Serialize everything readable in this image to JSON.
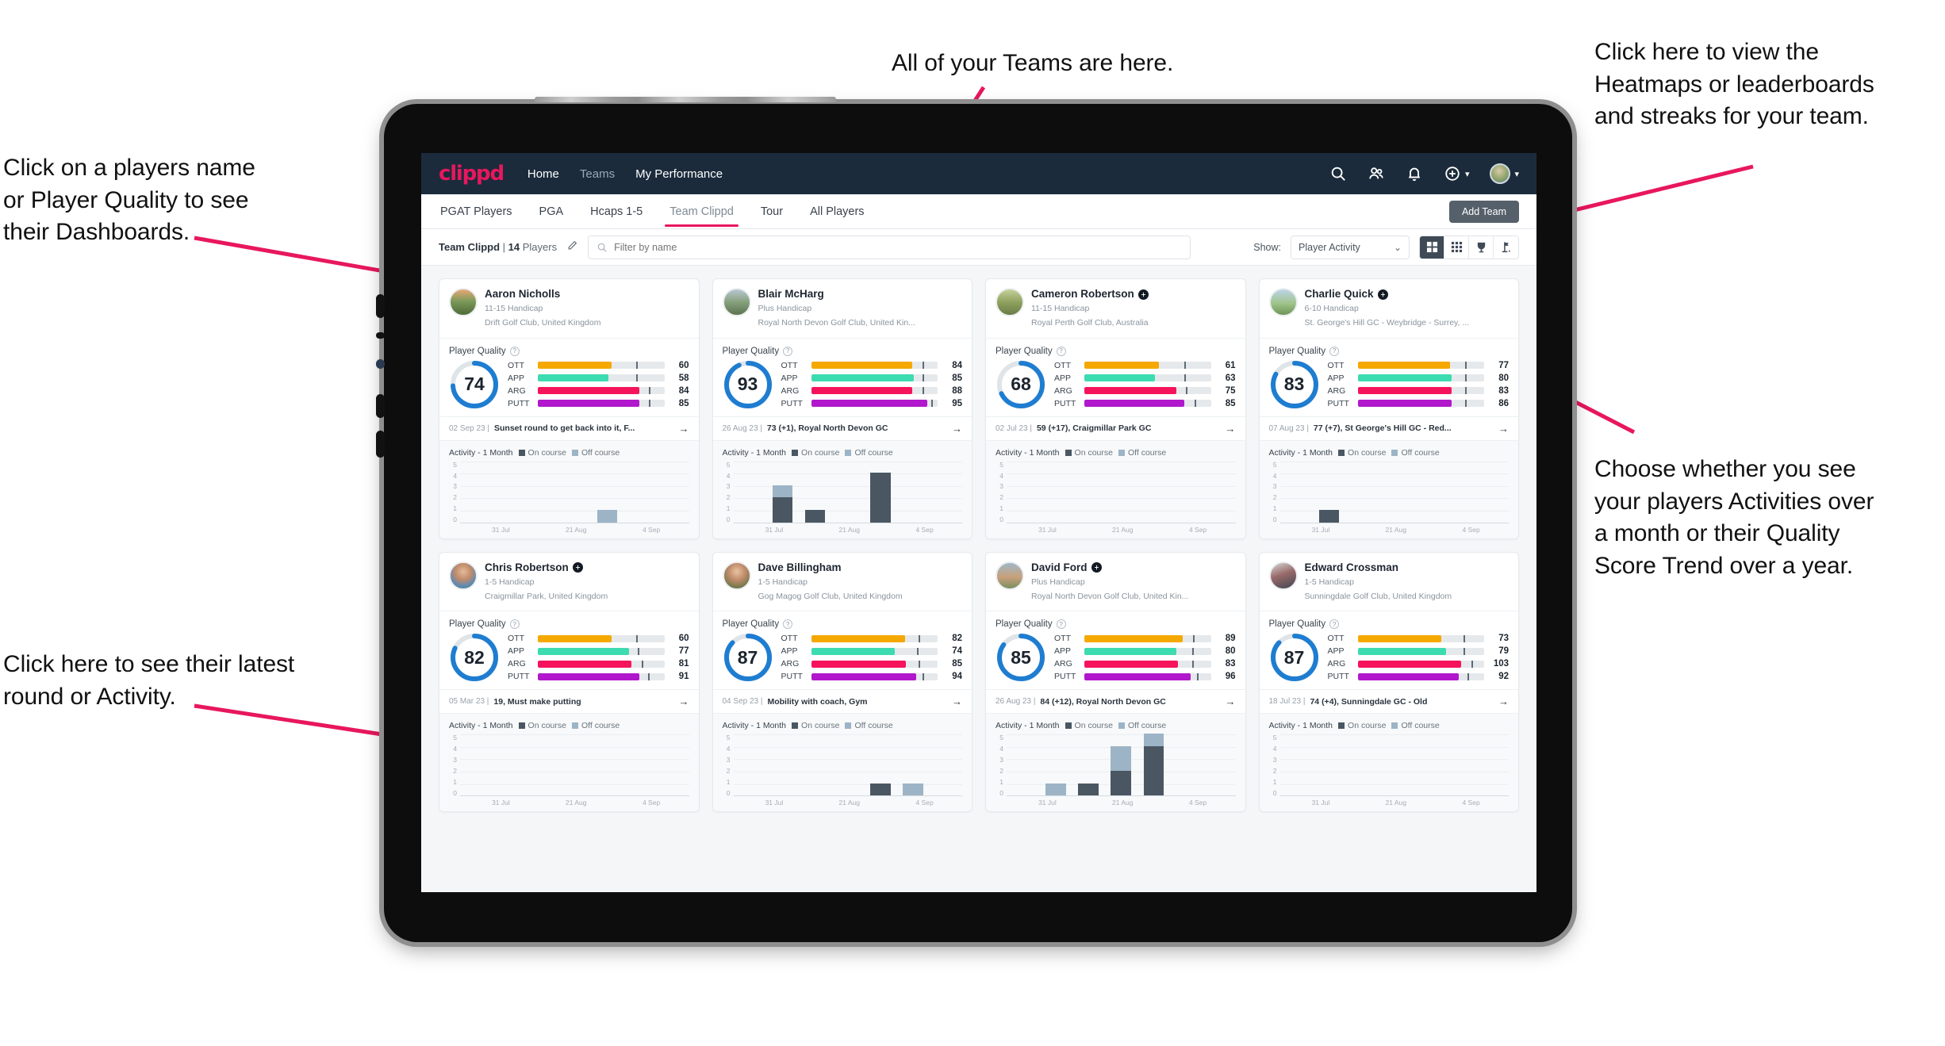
{
  "annotations": {
    "teams": "All of your Teams are here.",
    "right_top": "Click here to view the\nHeatmaps or leaderboards\nand streaks for your team.",
    "left_top": "Click on a players name\nor Player Quality to see\ntheir Dashboards.",
    "right_bottom": "Choose whether you see\nyour players Activities over\na month or their Quality\nScore Trend over a year.",
    "left_bottom": "Click here to see their latest\nround or Activity."
  },
  "colors": {
    "brand": "#e8175d",
    "nav_bg": "#1b2b3c",
    "ott": "#f5a800",
    "app": "#3ddbb0",
    "arg": "#f5145c",
    "putt": "#b117cc",
    "ring": "#1e7dd1",
    "on_course": "#4a5763",
    "off_course": "#9db4c6"
  },
  "topnav": {
    "brand": "clippd",
    "links": [
      {
        "label": "Home",
        "dim": false
      },
      {
        "label": "Teams",
        "dim": true
      },
      {
        "label": "My Performance",
        "dim": false
      }
    ],
    "icons": [
      "search-icon",
      "people-icon",
      "bell-icon",
      "plus-circle-icon",
      "avatar"
    ]
  },
  "tabs": {
    "items": [
      {
        "label": "PGAT Players",
        "active": false
      },
      {
        "label": "PGA",
        "active": false
      },
      {
        "label": "Hcaps 1-5",
        "active": false
      },
      {
        "label": "Team Clippd",
        "active": true
      },
      {
        "label": "Tour",
        "active": false
      },
      {
        "label": "All Players",
        "active": false
      }
    ],
    "add_team_label": "Add Team"
  },
  "filterbar": {
    "team_name": "Team Clippd",
    "separator": " | ",
    "player_count": "14",
    "players_word": " Players",
    "edit_icon": "pencil-icon",
    "search_placeholder": "Filter by name",
    "search_value": "",
    "show_label": "Show:",
    "show_value": "Player Activity",
    "show_options": [
      "Player Activity",
      "Quality Score Trend"
    ],
    "view_toggles": [
      {
        "name": "grid-large-view",
        "selected": true
      },
      {
        "name": "grid-small-view",
        "selected": false
      },
      {
        "name": "trophy-leaderboard-view",
        "selected": false
      },
      {
        "name": "heatmap-flag-view",
        "selected": false
      }
    ]
  },
  "card_labels": {
    "player_quality": "Player Quality",
    "activity": "Activity - 1 Month",
    "on_course": "On course",
    "off_course": "Off course",
    "metrics": [
      "OTT",
      "APP",
      "ARG",
      "PUTT"
    ],
    "y_ticks": [
      "5",
      "4",
      "3",
      "2",
      "1",
      "0"
    ],
    "x_ticks": [
      "31 Jul",
      "21 Aug",
      "4 Sep"
    ]
  },
  "players": [
    {
      "name": "Aaron Nicholls",
      "verified": false,
      "handicap": "11-15 Handicap",
      "club": "Drift Golf Club, United Kingdom",
      "quality": 74,
      "metrics": [
        {
          "label": "OTT",
          "value": 60,
          "fill": 58,
          "tick": 78
        },
        {
          "label": "APP",
          "value": 58,
          "fill": 56,
          "tick": 78
        },
        {
          "label": "ARG",
          "value": 84,
          "fill": 80,
          "tick": 88
        },
        {
          "label": "PUTT",
          "value": 85,
          "fill": 80,
          "tick": 88
        }
      ],
      "round_date": "02 Sep 23",
      "round_text": "Sunset round to get back into it, F...",
      "chart_data": {
        "type": "bar",
        "categories": [
          "31 Jul",
          "21 Aug",
          "4 Sep"
        ],
        "ylim": [
          0,
          5
        ],
        "series": [
          {
            "name": "On course",
            "values": [
              0,
              0,
              0,
              0,
              0,
              0,
              0
            ]
          },
          {
            "name": "Off course",
            "values": [
              0,
              0,
              0,
              0,
              1,
              0,
              0
            ]
          }
        ]
      }
    },
    {
      "name": "Blair McHarg",
      "verified": false,
      "handicap": "Plus Handicap",
      "club": "Royal North Devon Golf Club, United Kin...",
      "quality": 93,
      "metrics": [
        {
          "label": "OTT",
          "value": 84,
          "fill": 80,
          "tick": 88
        },
        {
          "label": "APP",
          "value": 85,
          "fill": 81,
          "tick": 88
        },
        {
          "label": "ARG",
          "value": 88,
          "fill": 80,
          "tick": 88
        },
        {
          "label": "PUTT",
          "value": 95,
          "fill": 92,
          "tick": 95
        }
      ],
      "round_date": "26 Aug 23",
      "round_text": "73 (+1), Royal North Devon GC",
      "chart_data": {
        "type": "bar",
        "categories": [
          "31 Jul",
          "21 Aug",
          "4 Sep"
        ],
        "ylim": [
          0,
          5
        ],
        "series": [
          {
            "name": "On course",
            "values": [
              0,
              2,
              1,
              0,
              4,
              0,
              0
            ]
          },
          {
            "name": "Off course",
            "values": [
              0,
              1,
              0,
              0,
              0,
              0,
              0
            ]
          }
        ]
      }
    },
    {
      "name": "Cameron Robertson",
      "verified": true,
      "handicap": "11-15 Handicap",
      "club": "Royal Perth Golf Club, Australia",
      "quality": 68,
      "metrics": [
        {
          "label": "OTT",
          "value": 61,
          "fill": 59,
          "tick": 79
        },
        {
          "label": "APP",
          "value": 63,
          "fill": 56,
          "tick": 79
        },
        {
          "label": "ARG",
          "value": 75,
          "fill": 73,
          "tick": 80
        },
        {
          "label": "PUTT",
          "value": 85,
          "fill": 79,
          "tick": 87
        }
      ],
      "round_date": "02 Jul 23",
      "round_text": "59 (+17), Craigmillar Park GC",
      "chart_data": {
        "type": "bar",
        "categories": [
          "31 Jul",
          "21 Aug",
          "4 Sep"
        ],
        "ylim": [
          0,
          5
        ],
        "series": [
          {
            "name": "On course",
            "values": [
              0,
              0,
              0,
              0,
              0,
              0,
              0
            ]
          },
          {
            "name": "Off course",
            "values": [
              0,
              0,
              0,
              0,
              0,
              0,
              0
            ]
          }
        ]
      }
    },
    {
      "name": "Charlie Quick",
      "verified": true,
      "handicap": "6-10 Handicap",
      "club": "St. George's Hill GC - Weybridge - Surrey, ...",
      "quality": 83,
      "metrics": [
        {
          "label": "OTT",
          "value": 77,
          "fill": 73,
          "tick": 85
        },
        {
          "label": "APP",
          "value": 80,
          "fill": 74,
          "tick": 85
        },
        {
          "label": "ARG",
          "value": 83,
          "fill": 74,
          "tick": 85
        },
        {
          "label": "PUTT",
          "value": 86,
          "fill": 74,
          "tick": 85
        }
      ],
      "round_date": "07 Aug 23",
      "round_text": "77 (+7), St George's Hill GC - Red...",
      "chart_data": {
        "type": "bar",
        "categories": [
          "31 Jul",
          "21 Aug",
          "4 Sep"
        ],
        "ylim": [
          0,
          5
        ],
        "series": [
          {
            "name": "On course",
            "values": [
              0,
              1,
              0,
              0,
              0,
              0,
              0
            ]
          },
          {
            "name": "Off course",
            "values": [
              0,
              0,
              0,
              0,
              0,
              0,
              0
            ]
          }
        ]
      }
    },
    {
      "name": "Chris Robertson",
      "verified": true,
      "handicap": "1-5 Handicap",
      "club": "Craigmillar Park, United Kingdom",
      "quality": 82,
      "metrics": [
        {
          "label": "OTT",
          "value": 60,
          "fill": 58,
          "tick": 78
        },
        {
          "label": "APP",
          "value": 77,
          "fill": 72,
          "tick": 79
        },
        {
          "label": "ARG",
          "value": 81,
          "fill": 74,
          "tick": 82
        },
        {
          "label": "PUTT",
          "value": 91,
          "fill": 80,
          "tick": 87
        }
      ],
      "round_date": "05 Mar 23",
      "round_text": "19, Must make putting",
      "chart_data": {
        "type": "bar",
        "categories": [
          "31 Jul",
          "21 Aug",
          "4 Sep"
        ],
        "ylim": [
          0,
          5
        ],
        "series": [
          {
            "name": "On course",
            "values": [
              0,
              0,
              0,
              0,
              0,
              0,
              0
            ]
          },
          {
            "name": "Off course",
            "values": [
              0,
              0,
              0,
              0,
              0,
              0,
              0
            ]
          }
        ]
      }
    },
    {
      "name": "Dave Billingham",
      "verified": false,
      "handicap": "1-5 Handicap",
      "club": "Gog Magog Golf Club, United Kingdom",
      "quality": 87,
      "metrics": [
        {
          "label": "OTT",
          "value": 82,
          "fill": 74,
          "tick": 85
        },
        {
          "label": "APP",
          "value": 74,
          "fill": 66,
          "tick": 84
        },
        {
          "label": "ARG",
          "value": 85,
          "fill": 75,
          "tick": 85
        },
        {
          "label": "PUTT",
          "value": 94,
          "fill": 83,
          "tick": 88
        }
      ],
      "round_date": "04 Sep 23",
      "round_text": "Mobility with coach, Gym",
      "chart_data": {
        "type": "bar",
        "categories": [
          "31 Jul",
          "21 Aug",
          "4 Sep"
        ],
        "ylim": [
          0,
          5
        ],
        "series": [
          {
            "name": "On course",
            "values": [
              0,
              0,
              0,
              0,
              1,
              0,
              0
            ]
          },
          {
            "name": "Off course",
            "values": [
              0,
              0,
              0,
              0,
              0,
              1,
              0
            ]
          }
        ]
      }
    },
    {
      "name": "David Ford",
      "verified": true,
      "handicap": "Plus Handicap",
      "club": "Royal North Devon Golf Club, United Kin...",
      "quality": 85,
      "metrics": [
        {
          "label": "OTT",
          "value": 89,
          "fill": 78,
          "tick": 86
        },
        {
          "label": "APP",
          "value": 80,
          "fill": 73,
          "tick": 85
        },
        {
          "label": "ARG",
          "value": 83,
          "fill": 74,
          "tick": 85
        },
        {
          "label": "PUTT",
          "value": 96,
          "fill": 84,
          "tick": 89
        }
      ],
      "round_date": "26 Aug 23",
      "round_text": "84 (+12), Royal North Devon GC",
      "chart_data": {
        "type": "bar",
        "categories": [
          "31 Jul",
          "21 Aug",
          "4 Sep"
        ],
        "ylim": [
          0,
          5
        ],
        "series": [
          {
            "name": "On course",
            "values": [
              0,
              0,
              1,
              2,
              4,
              0,
              0
            ]
          },
          {
            "name": "Off course",
            "values": [
              0,
              1,
              0,
              2,
              1,
              0,
              0
            ]
          }
        ]
      }
    },
    {
      "name": "Edward Crossman",
      "verified": false,
      "handicap": "1-5 Handicap",
      "club": "Sunningdale Golf Club, United Kingdom",
      "quality": 87,
      "metrics": [
        {
          "label": "OTT",
          "value": 73,
          "fill": 66,
          "tick": 84
        },
        {
          "label": "APP",
          "value": 79,
          "fill": 70,
          "tick": 84
        },
        {
          "label": "ARG",
          "value": 103,
          "fill": 82,
          "tick": 90
        },
        {
          "label": "PUTT",
          "value": 92,
          "fill": 80,
          "tick": 87
        }
      ],
      "round_date": "18 Jul 23",
      "round_text": "74 (+4), Sunningdale GC - Old",
      "chart_data": {
        "type": "bar",
        "categories": [
          "31 Jul",
          "21 Aug",
          "4 Sep"
        ],
        "ylim": [
          0,
          5
        ],
        "series": [
          {
            "name": "On course",
            "values": [
              0,
              0,
              0,
              0,
              0,
              0,
              0
            ]
          },
          {
            "name": "Off course",
            "values": [
              0,
              0,
              0,
              0,
              0,
              0,
              0
            ]
          }
        ]
      }
    }
  ]
}
